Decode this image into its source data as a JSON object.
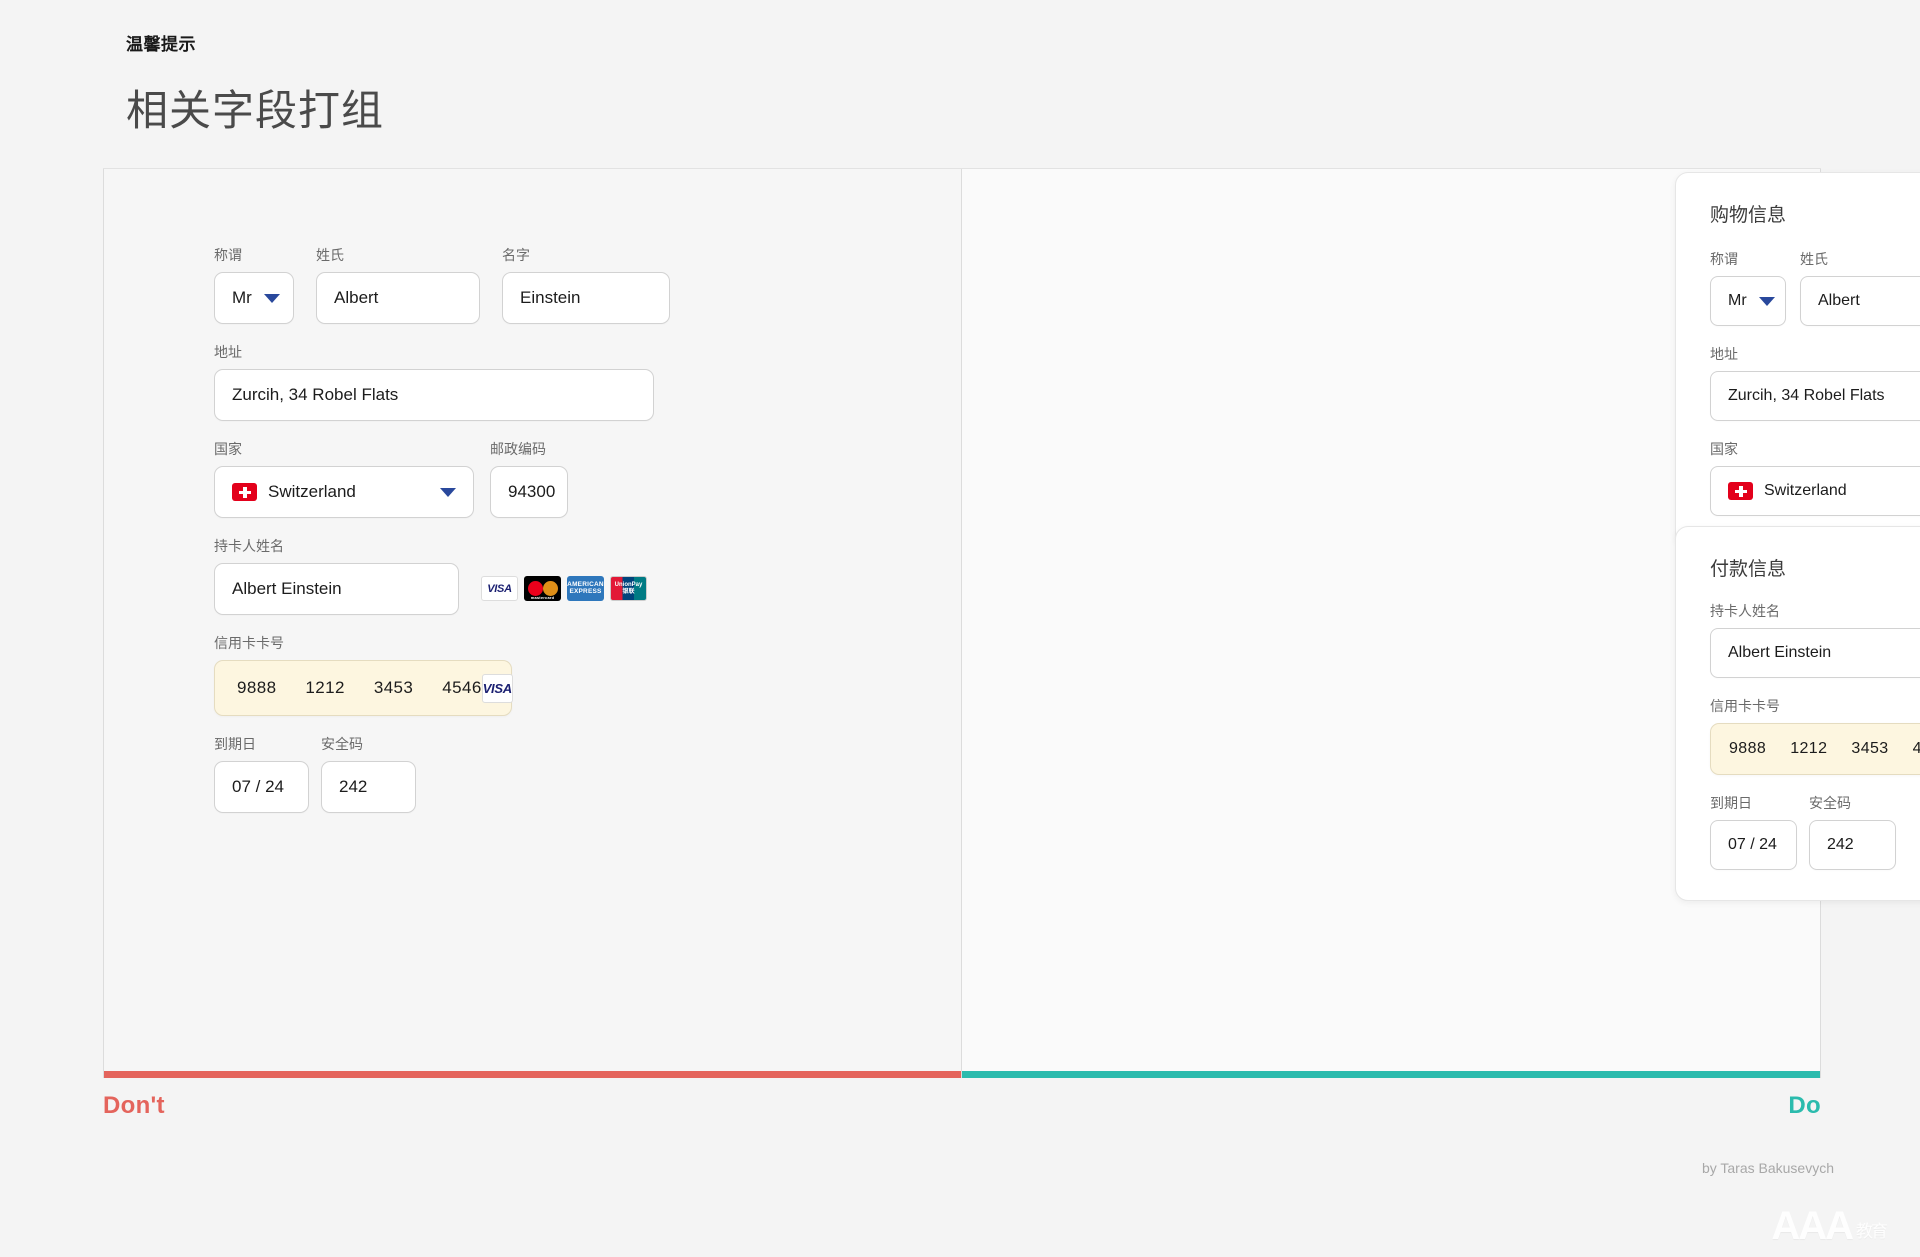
{
  "header": {
    "kicker": "温馨提示",
    "title": "相关字段打组"
  },
  "labels": {
    "title": "称谓",
    "last_name": "姓氏",
    "first_name": "名字",
    "address": "地址",
    "country": "国家",
    "postal_code": "邮政编码",
    "cardholder": "持卡人姓名",
    "card_number": "信用卡卡号",
    "expiry": "到期日",
    "cvv": "安全码"
  },
  "values": {
    "title": "Mr",
    "last_name": "Albert",
    "first_name": "Einstein",
    "address": "Zurcih, 34 Robel Flats",
    "country": "Switzerland",
    "postal_code": "94300",
    "cardholder": "Albert Einstein",
    "card_number_groups": [
      "9888",
      "1212",
      "3453",
      "4546"
    ],
    "expiry": "07 / 24",
    "cvv": "242"
  },
  "brands": {
    "visa": "VISA",
    "mastercard_top": "mastercard",
    "amex_line1": "AMERICAN",
    "amex_line2": "EXPRESS",
    "unionpay_line1": "UnionPay",
    "unionpay_line2": "银联"
  },
  "do_panel": {
    "card1_title": "购物信息",
    "card2_title": "付款信息"
  },
  "verdicts": {
    "dont": "Don't",
    "do": "Do"
  },
  "footer": {
    "credit": "by Taras Bakusevych",
    "watermark": "AAA",
    "watermark_cn": "教育"
  },
  "colors": {
    "dont": "#e4645c",
    "do": "#2bbbad",
    "chevron": "#29489c",
    "highlight_bg": "#fdf6e0",
    "flag_red": "#e3001b"
  }
}
